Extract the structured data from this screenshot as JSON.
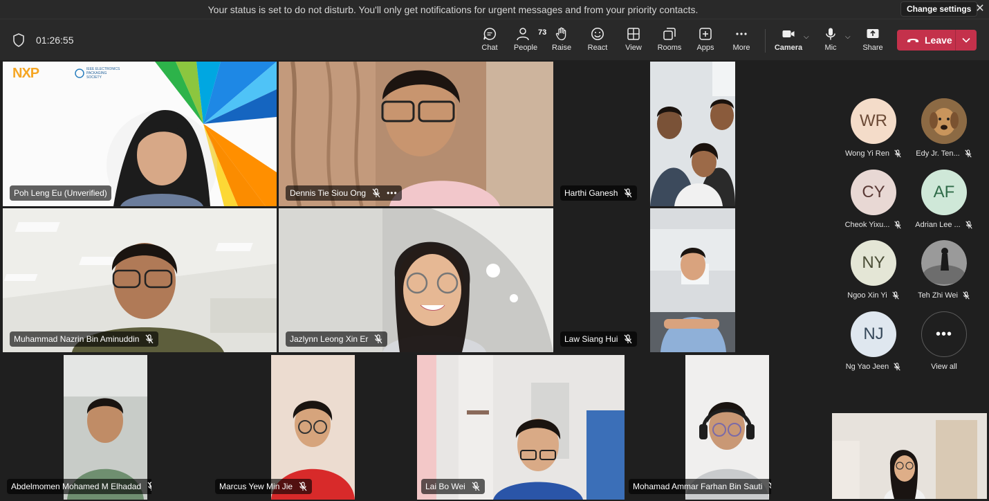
{
  "notification": {
    "message": "Your status is set to do not disturb. You'll only get notifications for urgent messages and from your priority contacts.",
    "button_label": "Change settings"
  },
  "meeting": {
    "duration": "01:26:55"
  },
  "toolbar": {
    "chat": "Chat",
    "people": "People",
    "people_count": "73",
    "raise": "Raise",
    "react": "React",
    "view": "View",
    "rooms": "Rooms",
    "apps": "Apps",
    "more": "More",
    "camera": "Camera",
    "mic": "Mic",
    "share": "Share",
    "leave": "Leave"
  },
  "video_tiles": [
    {
      "name": "Poh Leng Eu (Unverified)",
      "muted": false,
      "brand_logo": "NXP",
      "banner_text": "IEEE ELECTRONICS PACKAGING SOCIETY"
    },
    {
      "name": "Dennis Tie Siou Ong",
      "muted": true
    },
    {
      "name": "Harthi Ganesh",
      "muted": true
    },
    {
      "name": "Muhammad Nazrin Bin Aminuddin",
      "muted": true
    },
    {
      "name": "Jazlynn Leong Xin Er",
      "muted": true
    },
    {
      "name": "Law Siang Hui",
      "muted": true
    },
    {
      "name": "Abdelmomen Mohamed M Elhadad",
      "muted": true
    },
    {
      "name": "Marcus Yew Min Jie",
      "muted": true
    },
    {
      "name": "Lai Bo Wei",
      "muted": true
    },
    {
      "name": "Mohamad Ammar Farhan Bin Sauti",
      "muted": true
    }
  ],
  "roster": [
    {
      "initials": "WR",
      "name": "Wong Yi Ren",
      "color": "#f4dcc9"
    },
    {
      "initials": "",
      "name": "Edy Jr. Ten...",
      "color": "#a47848"
    },
    {
      "initials": "CY",
      "name": "Cheok Yixu...",
      "color": "#e8d8d4"
    },
    {
      "initials": "AF",
      "name": "Adrian Lee ...",
      "color": "#cfe8d8"
    },
    {
      "initials": "NY",
      "name": "Ngoo Xin Yi",
      "color": "#e4e6d6"
    },
    {
      "initials": "",
      "name": "Teh Zhi Wei",
      "color": "#5a5a5a"
    },
    {
      "initials": "NJ",
      "name": "Ng Yao Jeen",
      "color": "#dfe7ef"
    },
    {
      "initials": "",
      "name": "View all",
      "color": "#1f1f1f"
    }
  ],
  "colors": {
    "leave_red": "#c4314b",
    "bar_bg": "#292929",
    "stage_bg": "#1f1f1f"
  }
}
